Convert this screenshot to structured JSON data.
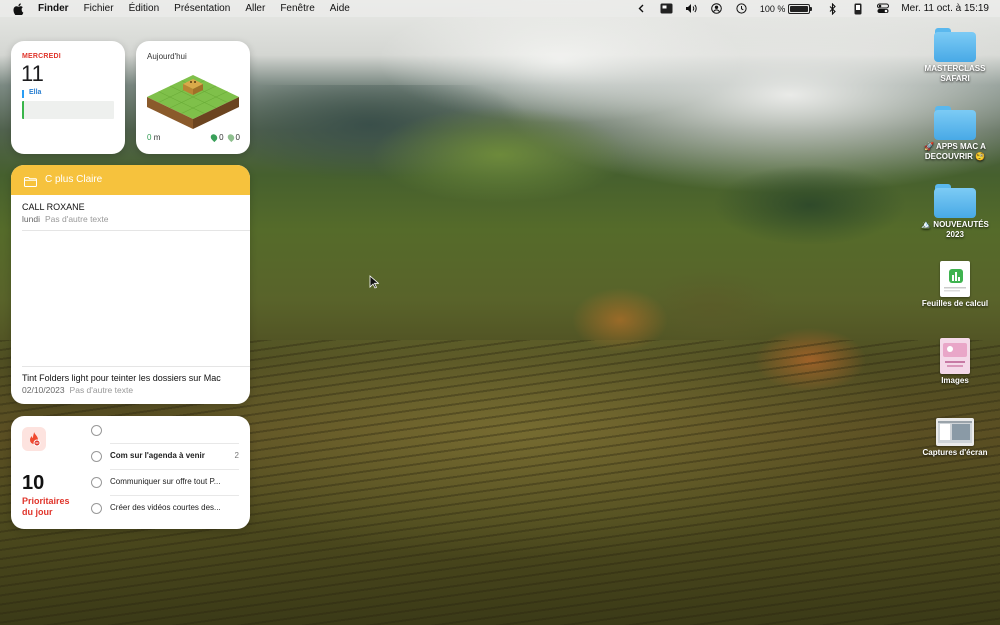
{
  "menubar": {
    "items": [
      "Finder",
      "Fichier",
      "Édition",
      "Présentation",
      "Aller",
      "Fenêtre",
      "Aide"
    ],
    "status_icons": [
      "chevron-left-icon",
      "control-center-icon",
      "volume-icon",
      "user-icon",
      "time-machine-icon"
    ],
    "battery_percent": "100 %",
    "battery_level": 1.0,
    "clock": "Mer. 11 oct. à 15:19"
  },
  "calendar_widget": {
    "day": "MERCREDI",
    "date": "11",
    "event_title": "Ella",
    "accent_color": "#e0352b"
  },
  "game_widget": {
    "title": "Aujourd'hui",
    "distance": "0",
    "distance_unit": "m",
    "count_a": "0",
    "count_b": "0"
  },
  "notes_widget": {
    "folder": "C plus Claire",
    "header_color": "#f6c23d",
    "notes": [
      {
        "title": "CALL ROXANE",
        "date": "lundi",
        "preview": "Pas d'autre texte"
      },
      {
        "title": "Tint Folders light pour teinter les dossiers sur Mac",
        "date": "02/10/2023",
        "preview": "Pas d'autre texte"
      }
    ]
  },
  "todo_widget": {
    "count": "10",
    "label_line1": "Prioritaires",
    "label_line2": "du jour",
    "tasks": [
      {
        "text": "",
        "count": ""
      },
      {
        "text": "Com sur l'agenda à venir",
        "count": "2"
      },
      {
        "text": "Communiquer sur offre tout P...",
        "count": ""
      },
      {
        "text": "Créer des vidéos courtes des...",
        "count": ""
      }
    ]
  },
  "desktop_icons": [
    {
      "label_line1": "MASTERCLASS",
      "label_line2": "SAFARI",
      "icon": "folder-icon"
    },
    {
      "label_line1": "🚀 APPS MAC A",
      "label_line2": "DECOUVRIR 🧐",
      "icon": "folder-icon"
    },
    {
      "label_line1": "🏔️ NOUVEAUTÉS",
      "label_line2": "2023",
      "icon": "folder-icon"
    },
    {
      "label_line1": "Feuilles de calcul",
      "label_line2": "",
      "icon": "spreadsheet-icon"
    },
    {
      "label_line1": "Images",
      "label_line2": "",
      "icon": "image-file-icon"
    },
    {
      "label_line1": "Captures d'écran",
      "label_line2": "",
      "icon": "screenshot-file-icon"
    }
  ]
}
